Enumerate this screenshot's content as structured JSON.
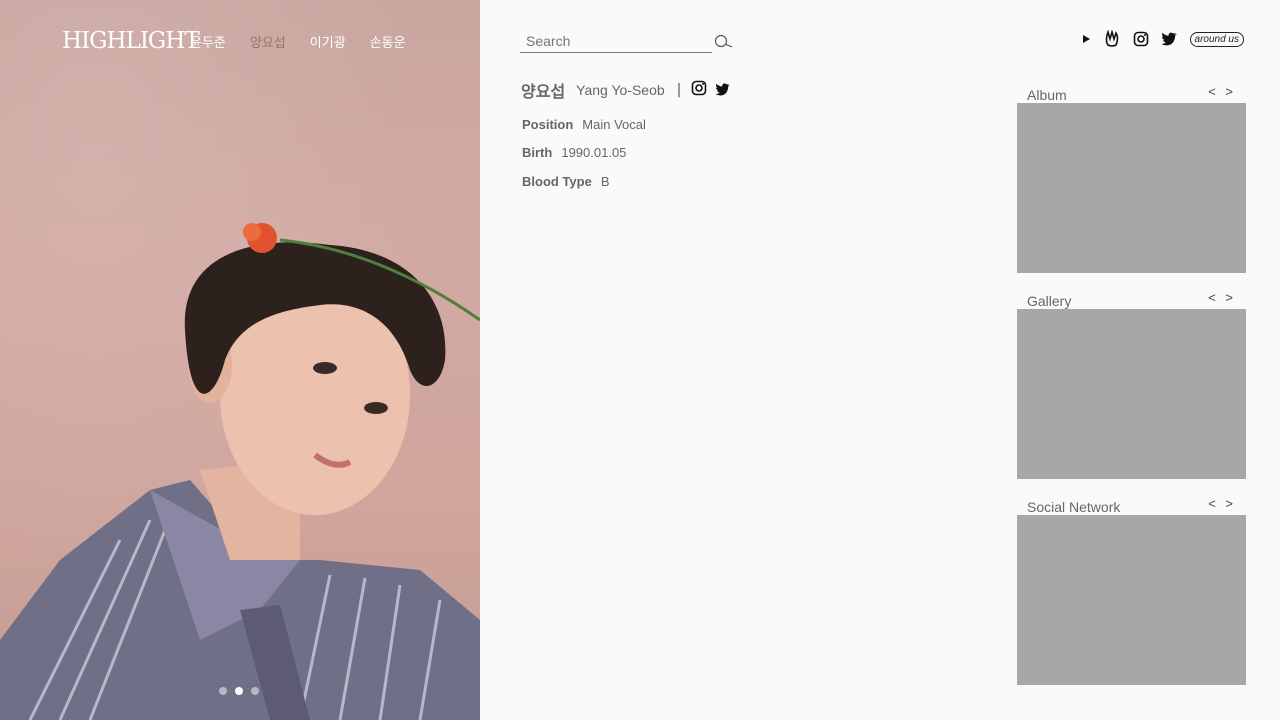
{
  "header": {
    "logo": "HIGHLIGHT",
    "members": [
      "윤두준",
      "양요섭",
      "이기광",
      "손동운"
    ],
    "active_member_index": 1
  },
  "search": {
    "placeholder": "Search"
  },
  "top_social": {
    "icons": [
      "play-icon",
      "vlive-icon",
      "instagram-icon",
      "twitter-icon",
      "around-us-logo-icon"
    ],
    "around_us_label": "around us"
  },
  "profile": {
    "name_ko": "양요섭",
    "name_en": "Yang Yo-Seob",
    "separator": "|",
    "position_label": "Position",
    "position_value": "Main Vocal",
    "birth_label": "Birth",
    "birth_value": "1990.01.05",
    "blood_label": "Blood Type",
    "blood_value": "B"
  },
  "cards": [
    {
      "title": "Album",
      "prev": "<",
      "next": ">"
    },
    {
      "title": "Gallery",
      "prev": "<",
      "next": ">"
    },
    {
      "title": "Social Network",
      "prev": "<",
      "next": ">"
    }
  ],
  "slider": {
    "count": 3,
    "active_index": 1
  },
  "colors": {
    "active_nav": "#9e6e6e",
    "card_placeholder": "#a7a7a7"
  }
}
